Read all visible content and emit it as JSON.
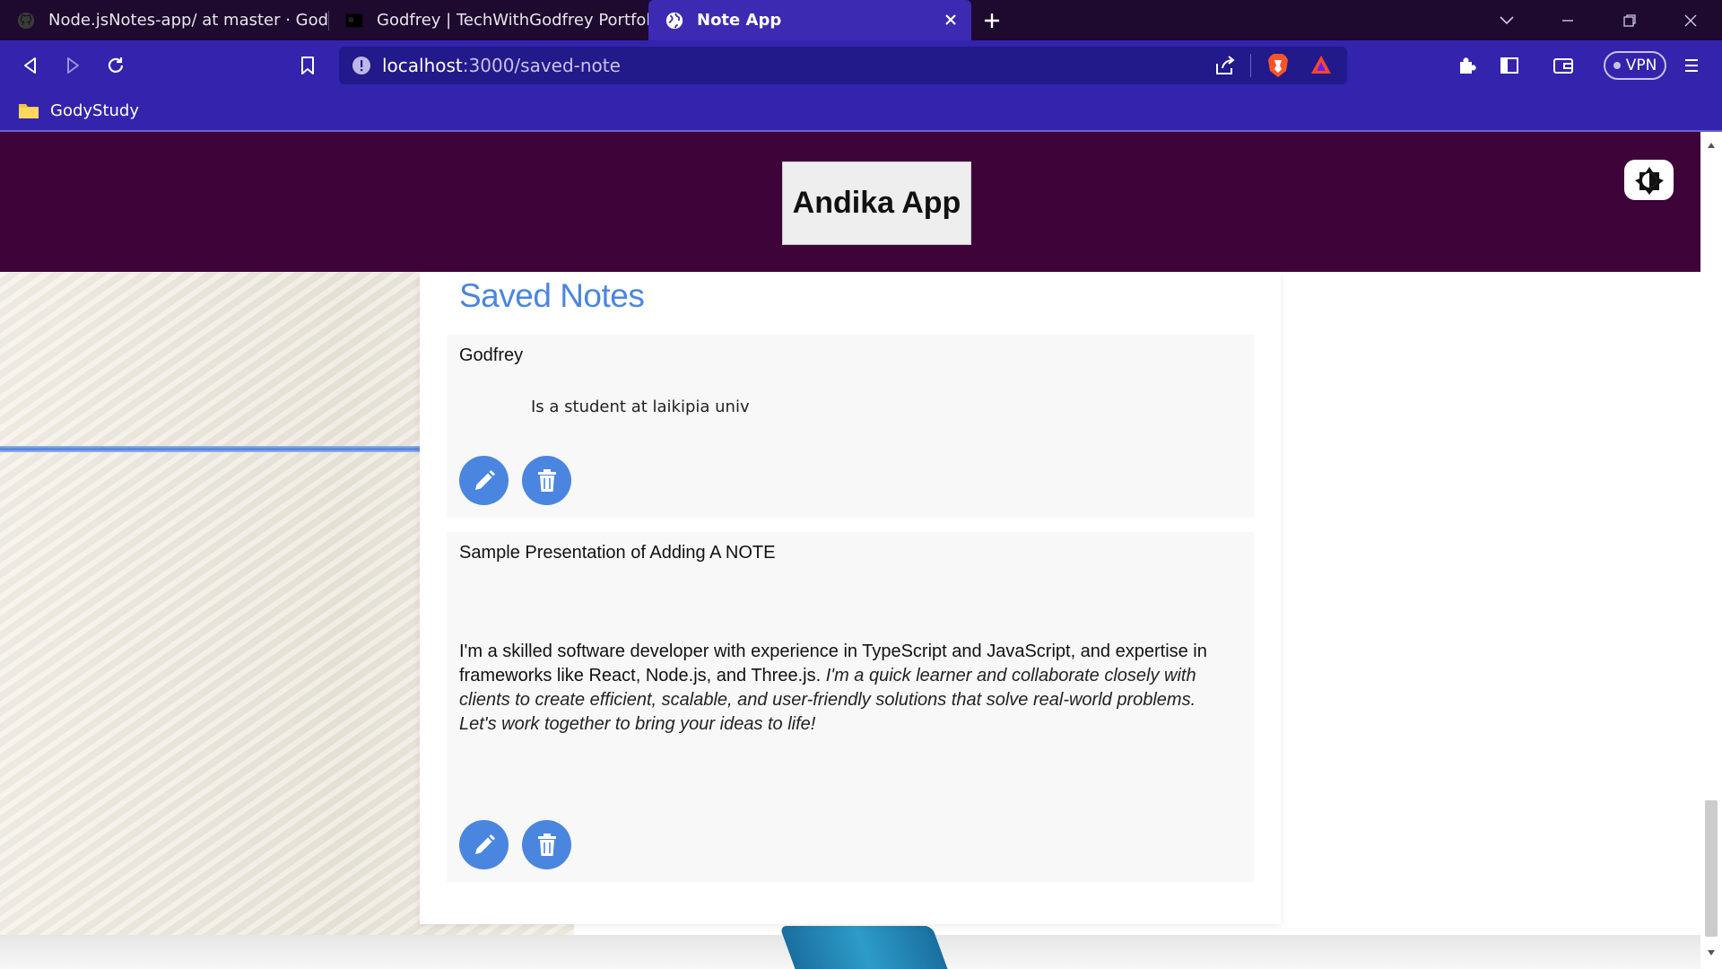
{
  "browser": {
    "tabs": [
      {
        "title": "Node.jsNotes-app/ at master · GodyRe",
        "icon": "github-icon",
        "active": false
      },
      {
        "title": "Godfrey | TechWithGodfrey Portfolio",
        "icon": "site-favicon-icon",
        "active": false
      },
      {
        "title": "Note App",
        "icon": "globe-icon",
        "active": true
      }
    ],
    "url_host": "localhost",
    "url_path": ":3000/saved-note",
    "vpn_label": "VPN",
    "bookmarks": [
      {
        "label": "GodyStudy",
        "icon": "folder-icon"
      }
    ],
    "colors": {
      "titlebar": "#1d0a2e",
      "toolbar": "#3323ad",
      "active_tab": "#3c2ab3"
    }
  },
  "app": {
    "brand": "Andika App",
    "header_color": "#3e0338",
    "accent": "#4a86e0"
  },
  "main": {
    "title": "Saved Notes",
    "notes": [
      {
        "title": "Godfrey",
        "body": "Is a student at laikipia univ"
      },
      {
        "title": "Sample Presentation of Adding A NOTE",
        "body_plain": "I'm a skilled software developer with experience in TypeScript and JavaScript, and expertise in frameworks like React, Node.js, and Three.js.",
        "body_italic": "I'm a quick learner and collaborate closely with clients to create efficient, scalable, and user-friendly solutions that solve real-world problems. Let's work together to bring your ideas to life!"
      }
    ]
  }
}
